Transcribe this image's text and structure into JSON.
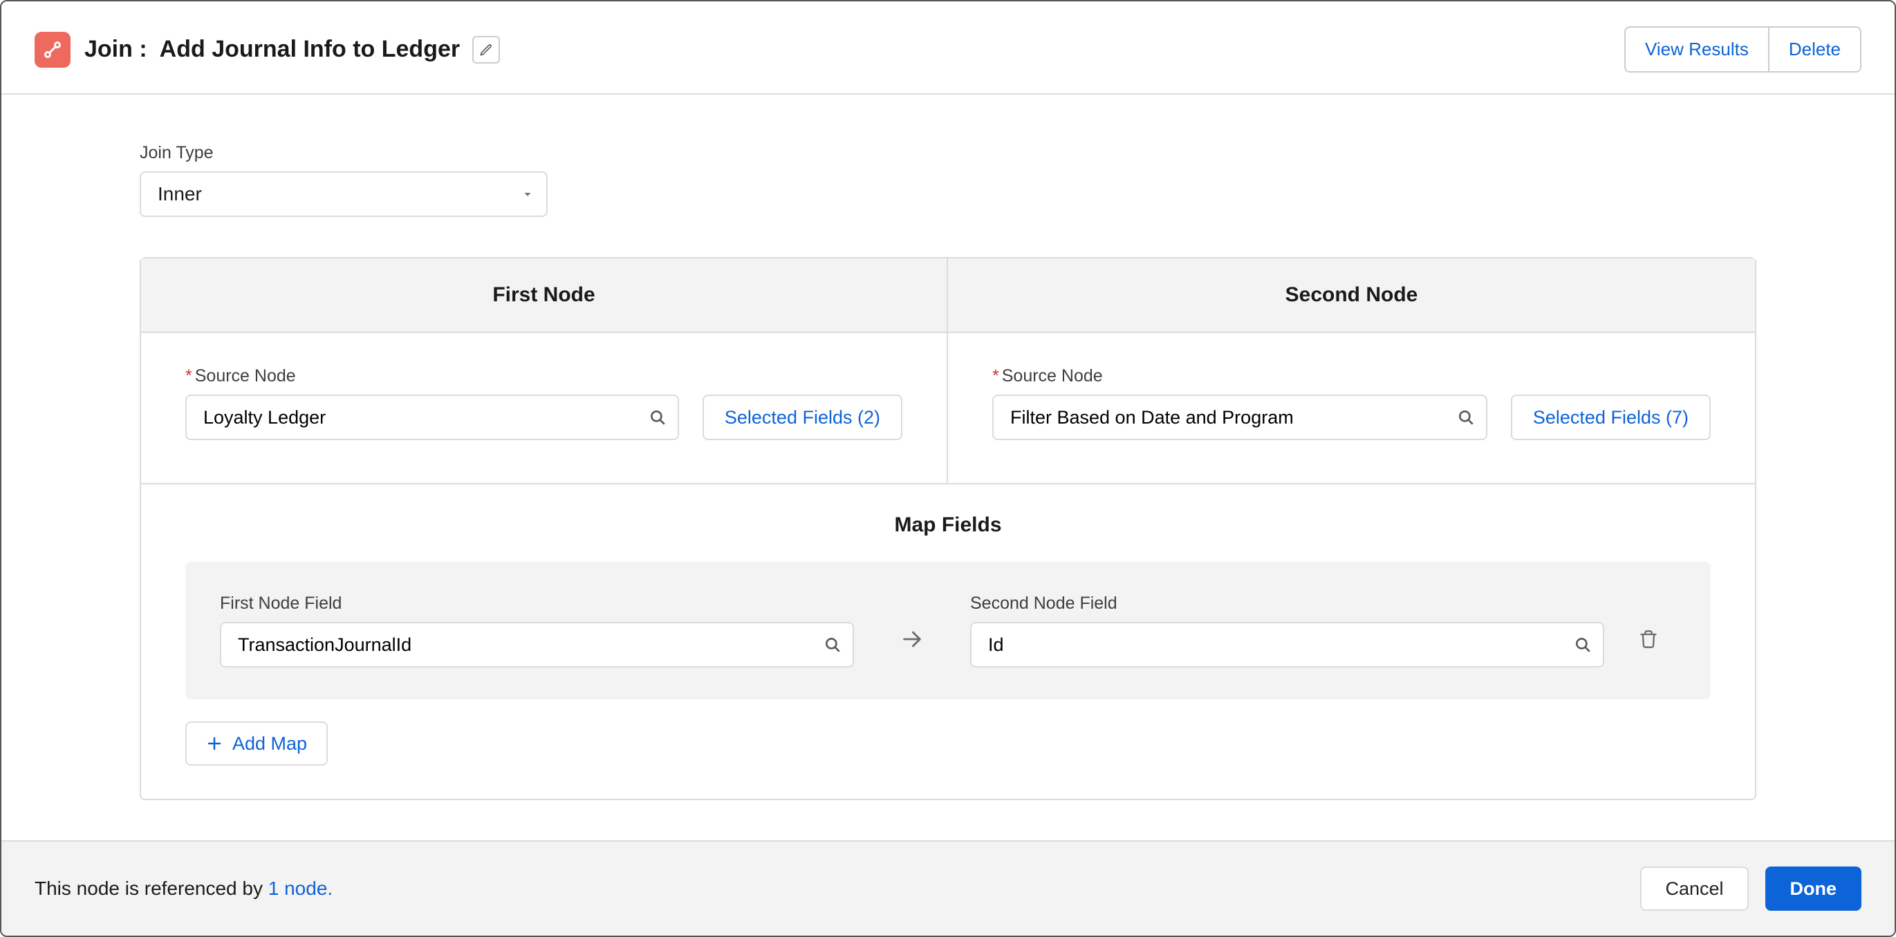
{
  "header": {
    "prefix": "Join :",
    "name": "Add Journal Info to Ledger",
    "actions": {
      "view_results": "View Results",
      "delete": "Delete"
    }
  },
  "join_type": {
    "label": "Join Type",
    "value": "Inner"
  },
  "nodes": {
    "first": {
      "heading": "First Node",
      "source_label": "Source Node",
      "source_value": "Loyalty Ledger",
      "selected_fields_label": "Selected Fields (2)"
    },
    "second": {
      "heading": "Second Node",
      "source_label": "Source Node",
      "source_value": "Filter Based on Date and Program",
      "selected_fields_label": "Selected Fields (7)"
    }
  },
  "map": {
    "title": "Map Fields",
    "first_label": "First Node Field",
    "first_value": "TransactionJournalId",
    "second_label": "Second Node Field",
    "second_value": "Id",
    "add_label": "Add Map"
  },
  "footer": {
    "text_prefix": "This node is referenced by ",
    "link_text": "1 node.",
    "cancel": "Cancel",
    "done": "Done"
  }
}
